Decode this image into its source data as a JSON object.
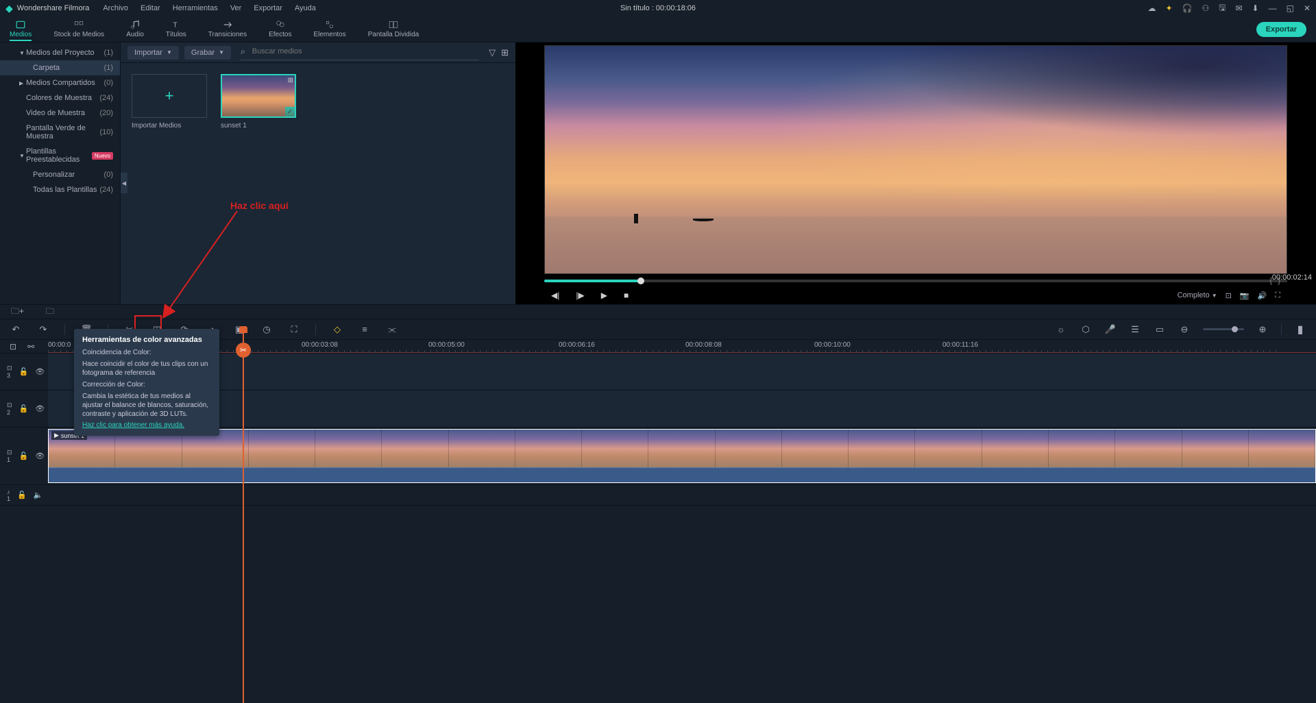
{
  "titlebar": {
    "appname": "Wondershare Filmora",
    "menu": [
      "Archivo",
      "Editar",
      "Herramientas",
      "Ver",
      "Exportar",
      "Ayuda"
    ],
    "project_title": "Sin título : 00:00:18:06"
  },
  "tabs": {
    "items": [
      "Medios",
      "Stock de Medios",
      "Audio",
      "Títulos",
      "Transiciones",
      "Efectos",
      "Elementos",
      "Pantalla Dividida"
    ],
    "export": "Exportar"
  },
  "sidebar": {
    "items": [
      {
        "label": "Medios del Proyecto",
        "count": "(1)",
        "arrow": "▼",
        "cls": "mid"
      },
      {
        "label": "Carpeta",
        "count": "(1)",
        "arrow": "",
        "cls": "sub active"
      },
      {
        "label": "Medios Compartidos",
        "count": "(0)",
        "arrow": "▶",
        "cls": "mid"
      },
      {
        "label": "Colores de Muestra",
        "count": "(24)",
        "arrow": "",
        "cls": "mid"
      },
      {
        "label": "Video de Muestra",
        "count": "(20)",
        "arrow": "",
        "cls": "mid"
      },
      {
        "label": "Pantalla Verde de Muestra",
        "count": "(10)",
        "arrow": "",
        "cls": "mid"
      },
      {
        "label": "Plantillas Preestablecidas",
        "count": "",
        "arrow": "▼",
        "cls": "mid",
        "badge": "Nuevo"
      },
      {
        "label": "Personalizar",
        "count": "(0)",
        "arrow": "",
        "cls": "sub"
      },
      {
        "label": "Todas las Plantillas",
        "count": "(24)",
        "arrow": "",
        "cls": "sub"
      }
    ]
  },
  "media_toolbar": {
    "importar": "Importar",
    "grabar": "Grabar",
    "search_placeholder": "Buscar medios"
  },
  "media": {
    "import_label": "Importar Medios",
    "clip1_name": "sunset 1"
  },
  "annotation_text": "Haz clic aquí",
  "preview": {
    "timecode": "00:00:02:14",
    "quality": "Completo"
  },
  "tooltip": {
    "title": "Herramientas de color avanzadas",
    "sub1_title": "Coincidencia de Color:",
    "sub1_body": "Hace coincidir el color de tus clips con un fotograma de referencia",
    "sub2_title": "Corrección de Color:",
    "sub2_body": "Cambia la estética de tus medios al ajustar el balance de blancos, saturación, contraste y aplicación de 3D LUTs.",
    "link": "Haz clic para obtener más ayuda."
  },
  "timeline": {
    "ruler": [
      {
        "label": "00:00:0",
        "pos": 0
      },
      {
        "label": "00:00:03:08",
        "pos": 370
      },
      {
        "label": "00:00:05:00",
        "pos": 555
      },
      {
        "label": "00:00:06:16",
        "pos": 745
      },
      {
        "label": "00:00:08:08",
        "pos": 930
      },
      {
        "label": "00:00:10:00",
        "pos": 1118
      },
      {
        "label": "00:00:11:16",
        "pos": 1305
      }
    ],
    "tracks": [
      {
        "label": "⊡ 3"
      },
      {
        "label": "⊡ 2"
      },
      {
        "label": "⊡ 1"
      },
      {
        "label": "♪ 1"
      }
    ],
    "clip1_name": "sunset 1"
  }
}
